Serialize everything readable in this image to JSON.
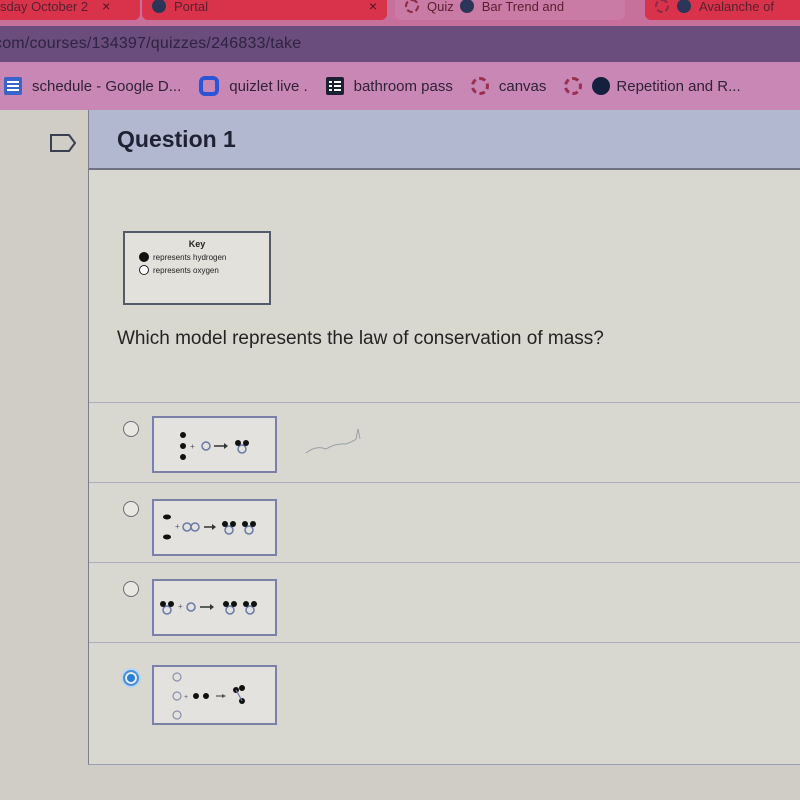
{
  "browser": {
    "tabs": [
      {
        "label": "sday October 2",
        "close": "×",
        "style": "red",
        "favicon": "none"
      },
      {
        "label": "Portal",
        "close": "×",
        "style": "red",
        "favicon": "dark"
      },
      {
        "label": "Quiz",
        "close": "",
        "style": "active",
        "favicon": "dashed"
      },
      {
        "label": "Bar Trend and",
        "close": "×",
        "style": "active",
        "favicon": "dark"
      },
      {
        "label": "Avalanche of",
        "close": "",
        "style": "red",
        "favicon": "dashed"
      }
    ],
    "url": "com/courses/134397/quizzes/246833/take",
    "bookmarks": [
      {
        "label": "schedule - Google D...",
        "icon": "google-docs-icon"
      },
      {
        "label": "quizlet live .",
        "icon": "quizlet-icon"
      },
      {
        "label": "bathroom pass",
        "icon": "list-icon"
      },
      {
        "label": "canvas",
        "icon": "canvas-icon"
      },
      {
        "label": "Repetition and R...",
        "icon": "canvas-icon",
        "extra_icon": "dot-icon"
      }
    ]
  },
  "question": {
    "title": "Question 1",
    "key": {
      "title": "Key",
      "items": [
        {
          "symbol": "filled-circle",
          "label": "represents hydrogen"
        },
        {
          "symbol": "open-circle",
          "label": "represents oxygen"
        }
      ]
    },
    "text": "Which model represents the law of conservation of mass?",
    "answers": [
      {
        "id": "a",
        "selected": false,
        "model": "3 H + 1 O → 1 H2O molecule"
      },
      {
        "id": "b",
        "selected": false,
        "model": "2 H2 + O2 → 2 H2O molecules"
      },
      {
        "id": "c",
        "selected": false,
        "model": "1 H2O + 1 O → 2 H2O molecules"
      },
      {
        "id": "d",
        "selected": true,
        "model": "3 O + 2 H → 1 molecule"
      }
    ]
  },
  "colors": {
    "selected_radio": "#2a7ed6",
    "header_bg": "#b3b8d1",
    "address_bar": "#6a4d7c",
    "bookmark_bar": "#c987b6",
    "tab_red": "#d8334a"
  }
}
